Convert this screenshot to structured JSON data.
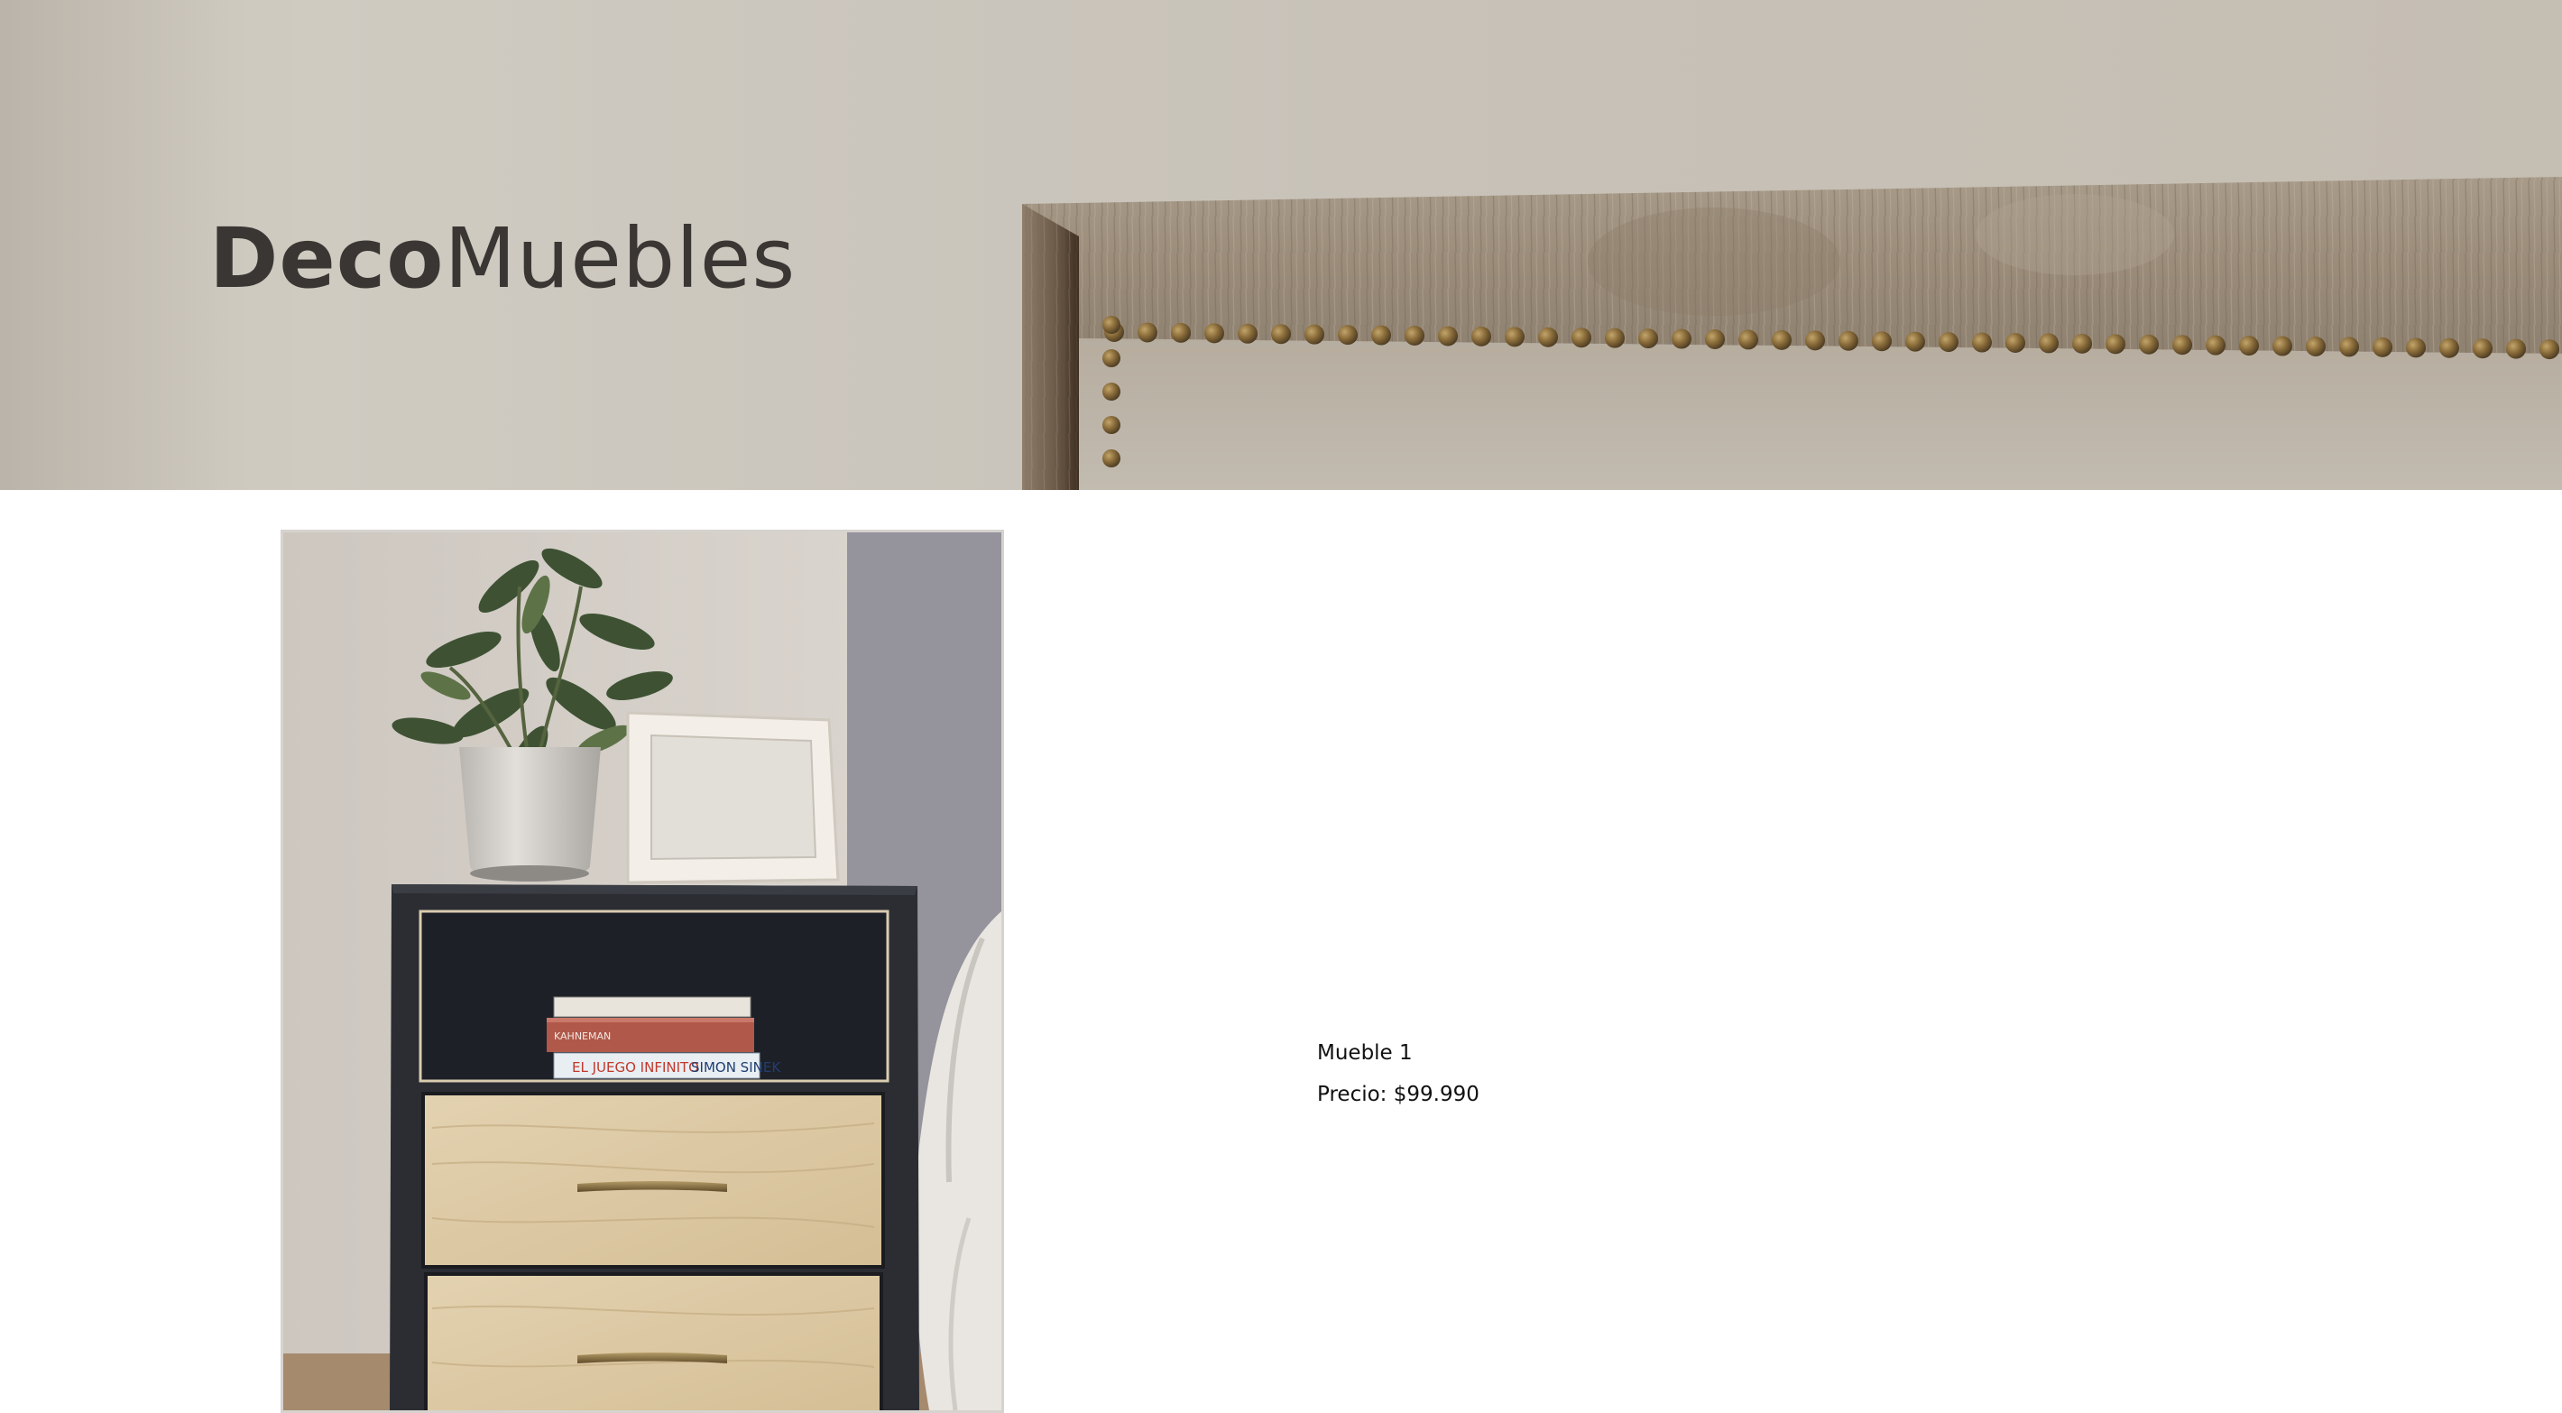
{
  "brand": {
    "bold": "Deco",
    "regular": "Muebles"
  },
  "hero": {
    "image": "upholstered-headboard-photo"
  },
  "product": {
    "image": "nightstand-photo",
    "name": "Mueble 1",
    "price": "Precio: $99.990",
    "book_spines": [
      "EL JUEGO INFINITO",
      "SIMON SINEK",
      "KAHNEMAN"
    ]
  },
  "colors": {
    "brand_text": "#3a3633",
    "body_text": "#111111",
    "background": "#ffffff"
  }
}
